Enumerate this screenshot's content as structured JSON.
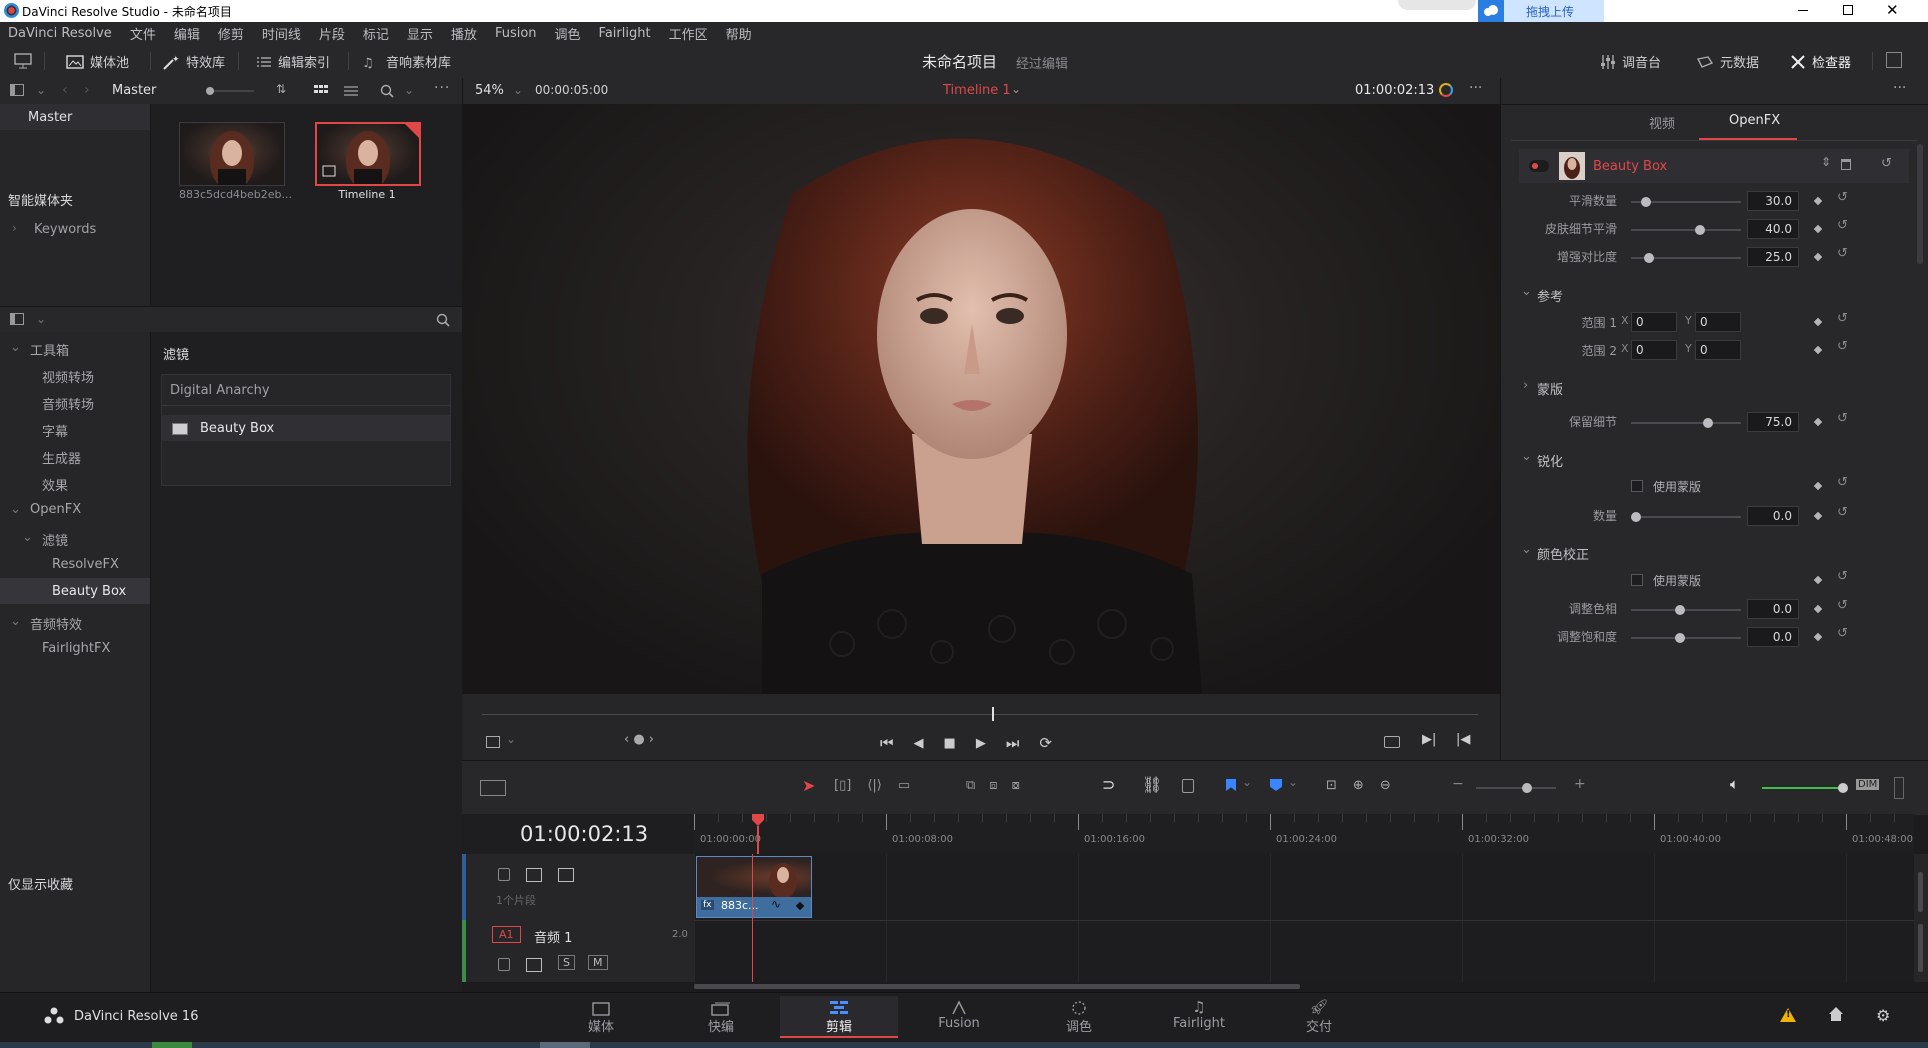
{
  "window": {
    "title": "DaVinci Resolve Studio - 未命名项目",
    "upload_label": "拖拽上传"
  },
  "menu": [
    "DaVinci Resolve",
    "文件",
    "编辑",
    "修剪",
    "时间线",
    "片段",
    "标记",
    "显示",
    "播放",
    "Fusion",
    "调色",
    "Fairlight",
    "工作区",
    "帮助"
  ],
  "toolbar": {
    "media_pool": "媒体池",
    "effects_library": "特效库",
    "edit_index": "编辑索引",
    "sound_library": "音响素材库",
    "project_name": "未命名项目",
    "project_status": "经过编辑",
    "mixer": "调音台",
    "metadata": "元数据",
    "inspector": "检查器"
  },
  "media_pool": {
    "bin_label": "Master",
    "tree_master": "Master",
    "smart_bins": "智能媒体夹",
    "keywords": "Keywords",
    "show_favorites": "仅显示收藏",
    "clips": [
      {
        "name": "883c5dcd4beb2eb..."
      },
      {
        "name": "Timeline 1"
      }
    ]
  },
  "effects": {
    "tree": [
      {
        "label": "工具箱",
        "level": 0,
        "caret": "v"
      },
      {
        "label": "视频转场",
        "level": 1
      },
      {
        "label": "音频转场",
        "level": 1
      },
      {
        "label": "字幕",
        "level": 1
      },
      {
        "label": "生成器",
        "level": 1
      },
      {
        "label": "效果",
        "level": 1
      },
      {
        "label": "OpenFX",
        "level": 0,
        "caret": "v"
      },
      {
        "label": "滤镜",
        "level": 1,
        "caret": "v"
      },
      {
        "label": "ResolveFX",
        "level": 2
      },
      {
        "label": "Beauty Box",
        "level": 2
      },
      {
        "label": "音频特效",
        "level": 0,
        "caret": "v"
      },
      {
        "label": "FairlightFX",
        "level": 1
      }
    ],
    "section_title": "滤镜",
    "group_title": "Digital Anarchy",
    "item": "Beauty Box"
  },
  "viewer": {
    "zoom": "54%",
    "duration": "00:00:05:00",
    "timeline_name": "Timeline 1",
    "timecode": "01:00:02:13"
  },
  "inspector": {
    "tabs": [
      "视频",
      "OpenFX"
    ],
    "effect_name": "Beauty Box",
    "params": [
      {
        "label": "平滑数量",
        "value": "30.0",
        "level": 0.1
      },
      {
        "label": "皮肤细节平滑",
        "value": "40.0",
        "level": 0.64
      },
      {
        "label": "增强对比度",
        "value": "25.0",
        "level": 0.13
      }
    ],
    "sections": {
      "reference": "参考",
      "range1": "范围 1",
      "range2": "范围 2",
      "x_label": "X",
      "y_label": "Y",
      "range_value": "0",
      "mask": "蒙版",
      "preserve_detail": "保留细节",
      "preserve_detail_value": "75.0",
      "sharpen": "锐化",
      "use_mask": "使用蒙版",
      "amount": "数量",
      "amount_value": "0.0",
      "color_correction": "颜色校正",
      "use_mask2": "使用蒙版",
      "hue": "调整色相",
      "hue_value": "0.0",
      "saturation": "调整饱和度",
      "saturation_value": "0.0"
    }
  },
  "timeline": {
    "timecode": "01:00:02:13",
    "ruler": [
      "01:00:00:00",
      "01:00:08:00",
      "01:00:16:00",
      "01:00:24:00",
      "01:00:32:00",
      "01:00:40:00",
      "01:00:48:00"
    ],
    "video_track_info": "1个片段",
    "clip_label": "883c...",
    "audio_track": {
      "id": "A1",
      "name": "音频 1",
      "channels": "2.0"
    },
    "solo": "S",
    "mute": "M",
    "dim": "DIM"
  },
  "pages": [
    "媒体",
    "快编",
    "剪辑",
    "Fusion",
    "调色",
    "Fairlight",
    "交付"
  ],
  "active_page": "剪辑",
  "app_footer": "DaVinci Resolve 16",
  "colors": {
    "accent": "#e03a3a",
    "active_blue": "#3a86ff",
    "panel": "#262629"
  }
}
